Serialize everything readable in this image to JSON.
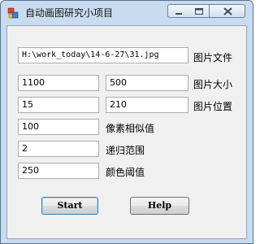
{
  "window": {
    "title": "自动画图研究小项目"
  },
  "form": {
    "file_path": {
      "value": "H:\\work_today\\14-6-27\\31.jpg",
      "label": "图片文件"
    },
    "size": {
      "width": "1100",
      "height": "500",
      "label": "图片大小"
    },
    "position": {
      "x": "15",
      "y": "210",
      "label": "图片位置"
    },
    "pixel_similarity": {
      "value": "100",
      "label": "像素相似值"
    },
    "recursion_range": {
      "value": "2",
      "label": "递归范围"
    },
    "color_threshold": {
      "value": "250",
      "label": "颜色阈值"
    }
  },
  "buttons": {
    "start": "Start",
    "help": "Help"
  }
}
